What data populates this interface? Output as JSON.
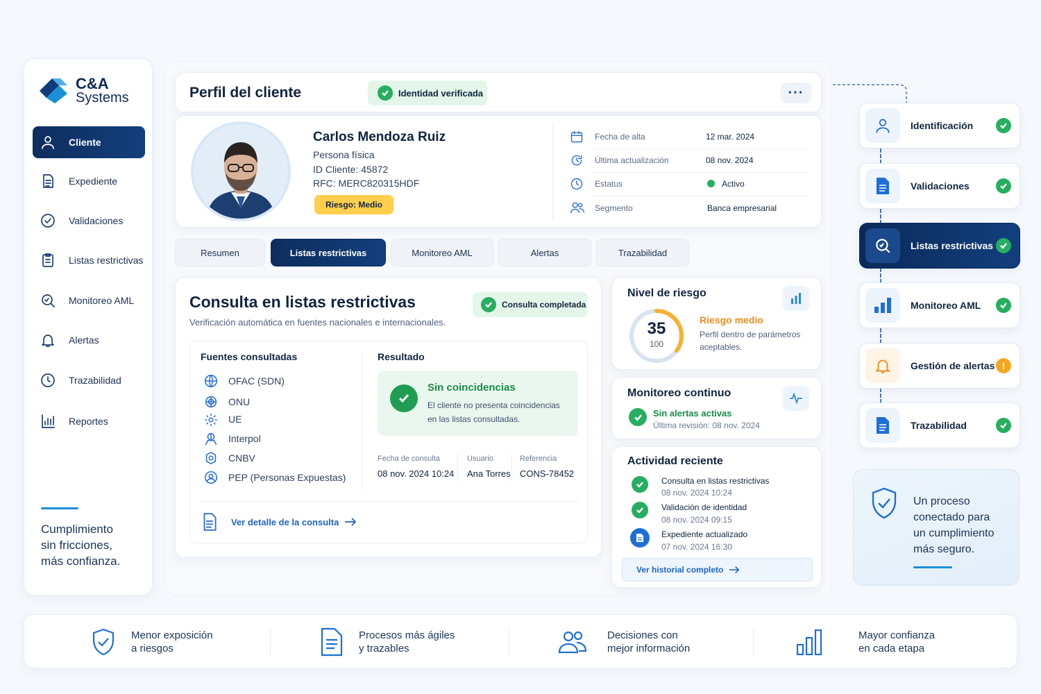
{
  "brand": {
    "name": "C&A",
    "sub": "Systems"
  },
  "sidebar": {
    "items": [
      {
        "label": "Cliente",
        "icon": "user-icon",
        "active": true
      },
      {
        "label": "Expediente",
        "icon": "document-icon"
      },
      {
        "label": "Validaciones",
        "icon": "check-circle-icon"
      },
      {
        "label": "Listas restrictivas",
        "icon": "list-icon"
      },
      {
        "label": "Monitoreo AML",
        "icon": "search-icon"
      },
      {
        "label": "Alertas",
        "icon": "bell-icon"
      },
      {
        "label": "Trazabilidad",
        "icon": "clock-icon"
      },
      {
        "label": "Reportes",
        "icon": "bar-chart-icon"
      }
    ],
    "tagline": [
      "Cumplimiento",
      "sin fricciones,",
      "más confianza."
    ]
  },
  "header": {
    "title": "Perfil del cliente",
    "badge": "Identidad verificada",
    "more": "···"
  },
  "client": {
    "name": "Carlos Mendoza Ruiz",
    "type": "Persona física",
    "id": "ID Cliente: 45872",
    "rfc": "RFC: MERC820315HDF",
    "risk_badge": "Riesgo: Medio",
    "details": [
      {
        "label": "Fecha de alta",
        "value": "12 mar. 2024",
        "icon": "calendar-icon"
      },
      {
        "label": "Última actualización",
        "value": "08 nov. 2024",
        "icon": "refresh-icon"
      },
      {
        "label": "Estatus",
        "value": "Activo",
        "icon": "status-icon"
      },
      {
        "label": "Segmento",
        "value": "Banca empresarial",
        "icon": "users-icon"
      }
    ]
  },
  "tabs": [
    "Resumen",
    "Listas restrictivas",
    "Monitoreo AML",
    "Alertas",
    "Trazabilidad"
  ],
  "consulta": {
    "title": "Consulta en listas restrictivas",
    "subtitle": "Verificación automática en fuentes nacionales e internacionales.",
    "badge": "Consulta completada",
    "sources_title": "Fuentes consultadas",
    "sources": [
      "OFAC (SDN)",
      "ONU",
      "UE",
      "Interpol",
      "CNBV",
      "PEP (Personas Expuestas)"
    ],
    "result_title": "Resultado",
    "result_heading": "Sin coincidencias",
    "result_text": [
      "El cliente no presenta coincidencias",
      "en las listas consultadas."
    ],
    "meta": [
      {
        "label": "Fecha de consulta",
        "value": "08 nov. 2024 10:24"
      },
      {
        "label": "Usuario",
        "value": "Ana Torres"
      },
      {
        "label": "Referencia",
        "value": "CONS-78452"
      }
    ],
    "detail_link": "Ver detalle de la consulta"
  },
  "risk": {
    "title": "Nivel de riesgo",
    "score": "35",
    "max": "100",
    "score_value": 35,
    "label": "Riesgo medio",
    "desc": [
      "Perfil dentro de parámetros",
      "aceptables."
    ]
  },
  "monitor": {
    "title": "Monitoreo continuo",
    "status": "Sin alertas activas",
    "last": "Última revisión: 08 nov. 2024"
  },
  "activity": {
    "title": "Actividad reciente",
    "items": [
      {
        "text": "Consulta en listas restrictivas",
        "date": "08 nov. 2024 10:24",
        "kind": "check"
      },
      {
        "text": "Validación de identidad",
        "date": "08 nov. 2024 09:15",
        "kind": "check"
      },
      {
        "text": "Expediente actualizado",
        "date": "07 nov. 2024 16:30",
        "kind": "doc"
      }
    ],
    "link": "Ver historial completo"
  },
  "flow": {
    "steps": [
      {
        "label": "Identificación",
        "status": "ok"
      },
      {
        "label": "Validaciones",
        "status": "ok"
      },
      {
        "label": "Listas restrictivas",
        "status": "ok",
        "active": true
      },
      {
        "label": "Monitoreo AML",
        "status": "ok"
      },
      {
        "label": "Gestión de alertas",
        "status": "warning"
      },
      {
        "label": "Trazabilidad",
        "status": "ok"
      }
    ],
    "promo": [
      "Un proceso",
      "conectado para",
      "un cumplimiento",
      "más seguro."
    ]
  },
  "benefits": [
    {
      "lines": [
        "Menor exposición",
        "a riesgos"
      ],
      "icon": "shield-check-icon"
    },
    {
      "lines": [
        "Procesos más ágiles",
        "y trazables"
      ],
      "icon": "document-icon"
    },
    {
      "lines": [
        "Decisiones con",
        "mejor información"
      ],
      "icon": "users-icon"
    },
    {
      "lines": [
        "Mayor confianza",
        "en cada etapa"
      ],
      "icon": "bar-chart-icon"
    }
  ],
  "colors": {
    "navy": "#0d2d5e",
    "accent": "#1a8fd8",
    "green": "#27ae60",
    "warning": "#f5a623",
    "risk_orange": "#f08c1b"
  }
}
